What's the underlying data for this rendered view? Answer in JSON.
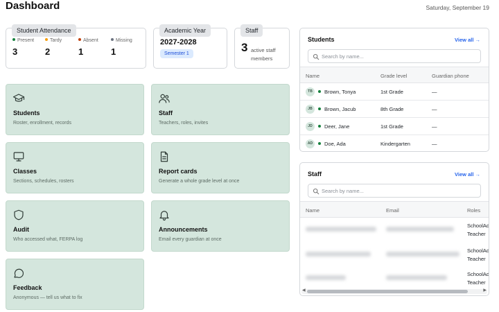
{
  "header": {
    "title": "Dashboard",
    "date": "Saturday, September 19"
  },
  "attendance": {
    "title": "Student Attendance",
    "items": [
      {
        "label": "Present",
        "value": "3",
        "color": "#15803d"
      },
      {
        "label": "Tardy",
        "value": "2",
        "color": "#f59e0b"
      },
      {
        "label": "Absent",
        "value": "1",
        "color": "#c2410c"
      },
      {
        "label": "Missing",
        "value": "1",
        "color": "#6b7280"
      }
    ]
  },
  "academic_year": {
    "title": "Academic Year",
    "value": "2027-2028",
    "semester": "Semester 1"
  },
  "staff_stat": {
    "title": "Staff",
    "count": "3",
    "caption": "active staff members"
  },
  "tiles": [
    {
      "title": "Students",
      "subtitle": "Roster, enrollment, records",
      "icon": "graduation-cap-icon"
    },
    {
      "title": "Staff",
      "subtitle": "Teachers, roles, invites",
      "icon": "users-icon"
    },
    {
      "title": "Classes",
      "subtitle": "Sections, schedules, rosters",
      "icon": "monitor-icon"
    },
    {
      "title": "Report cards",
      "subtitle": "Generate a whole grade level at once",
      "icon": "document-icon"
    },
    {
      "title": "Audit",
      "subtitle": "Who accessed what, FERPA log",
      "icon": "shield-icon"
    },
    {
      "title": "Announcements",
      "subtitle": "Email every guardian at once",
      "icon": "bell-icon"
    },
    {
      "title": "Feedback",
      "subtitle": "Anonymous — tell us what to fix",
      "icon": "chat-bubble-icon"
    }
  ],
  "students_panel": {
    "title": "Students",
    "view_all": "View all →",
    "search_placeholder": "Search by name...",
    "columns": [
      "Name",
      "Grade level",
      "Guardian phone"
    ],
    "rows": [
      {
        "initials": "TB",
        "name": "Brown, Tonya",
        "grade": "1st Grade",
        "phone": "—"
      },
      {
        "initials": "JB",
        "name": "Brown, Jacub",
        "grade": "8th Grade",
        "phone": "—"
      },
      {
        "initials": "JD",
        "name": "Deer, Jane",
        "grade": "1st Grade",
        "phone": "—"
      },
      {
        "initials": "AD",
        "name": "Doe, Ada",
        "grade": "Kindergarten",
        "phone": "—"
      }
    ]
  },
  "staff_panel": {
    "title": "Staff",
    "view_all": "View all →",
    "search_placeholder": "Search by name...",
    "columns": [
      "Name",
      "Email",
      "Roles"
    ],
    "rows": [
      {
        "roles": [
          "SchoolAd",
          "Teacher"
        ]
      },
      {
        "roles": [
          "SchoolAd",
          "Teacher"
        ]
      },
      {
        "roles": [
          "SchoolAd",
          "Teacher"
        ]
      }
    ]
  }
}
